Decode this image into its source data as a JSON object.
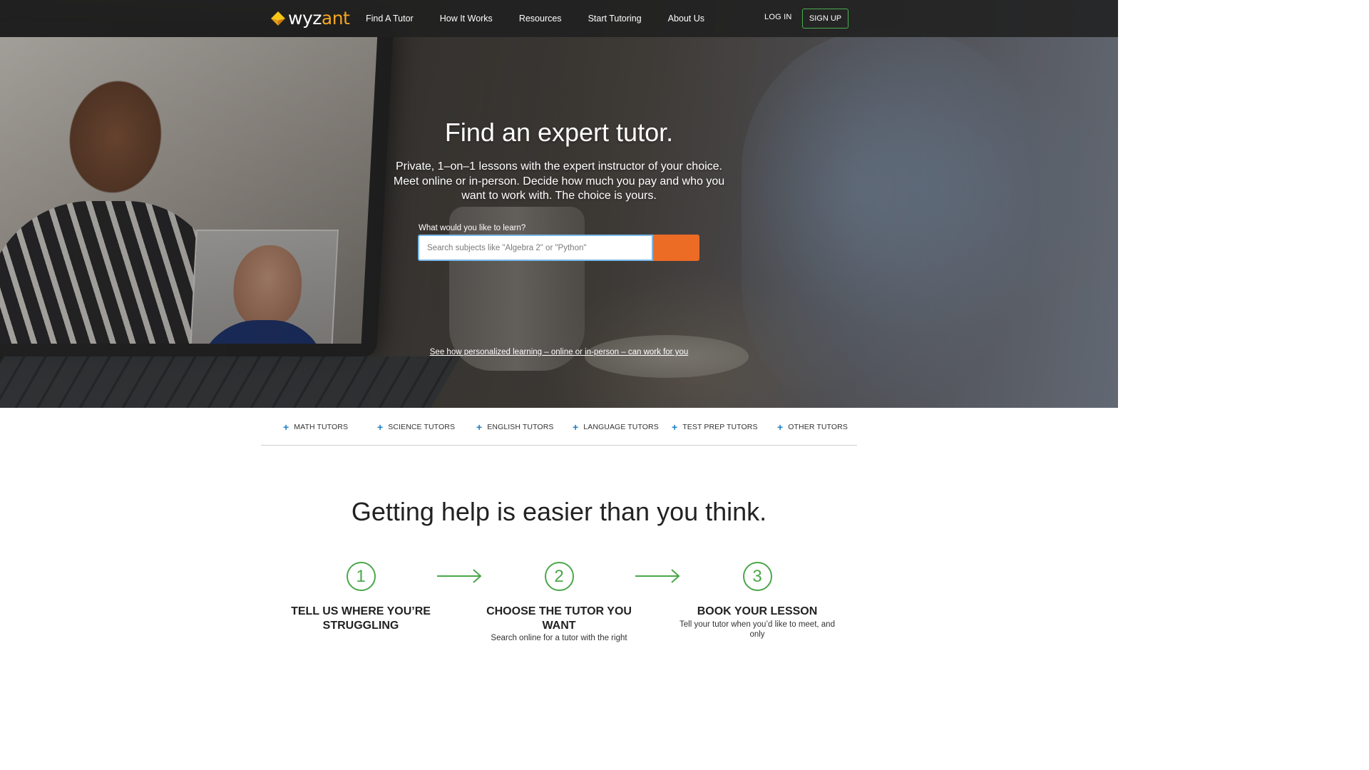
{
  "nav": {
    "logo_main": "wyz",
    "logo_accent": "ant",
    "links": [
      "Find A Tutor",
      "How It Works",
      "Resources",
      "Start Tutoring",
      "About Us"
    ],
    "login_label": "LOG IN",
    "signup_label": "SIGN UP"
  },
  "hero": {
    "title": "Find an expert tutor.",
    "subtitle": "Private, 1–on–1 lessons with the expert instructor of your choice. Meet online or in-person. Decide how much you pay and who you want to work with. The choice is yours.",
    "search_label": "What would you like to learn?",
    "search_placeholder": "Search subjects like \"Algebra 2\" or \"Python\"",
    "search_value": "",
    "link_text": "See how personalized learning – online or in-person – can work for you"
  },
  "subjects": {
    "items": [
      "MATH TUTORS",
      "SCIENCE TUTORS",
      "ENGLISH TUTORS",
      "LANGUAGE TUTORS",
      "TEST PREP TUTORS",
      "OTHER TUTORS"
    ]
  },
  "how_it_works": {
    "title": "Getting help is easier than you think.",
    "steps": [
      {
        "number": "1",
        "title": "TELL US WHERE YOU’RE STRUGGLING",
        "desc": ""
      },
      {
        "number": "2",
        "title": "CHOOSE THE TUTOR YOU WANT",
        "desc": "Search online for a tutor with the right"
      },
      {
        "number": "3",
        "title": "BOOK YOUR LESSON",
        "desc": "Tell your tutor when you’d like to meet, and only"
      }
    ]
  },
  "colors": {
    "accent_orange": "#ec6b25",
    "brand_green": "#4aa74a",
    "plus_blue": "#1f7fc4",
    "logo_yellow": "#f5a623"
  },
  "icons": {
    "logo": "wyzant-diamond-icon",
    "subject_plus": "plus-icon",
    "step_arrow": "arrow-right-icon"
  }
}
